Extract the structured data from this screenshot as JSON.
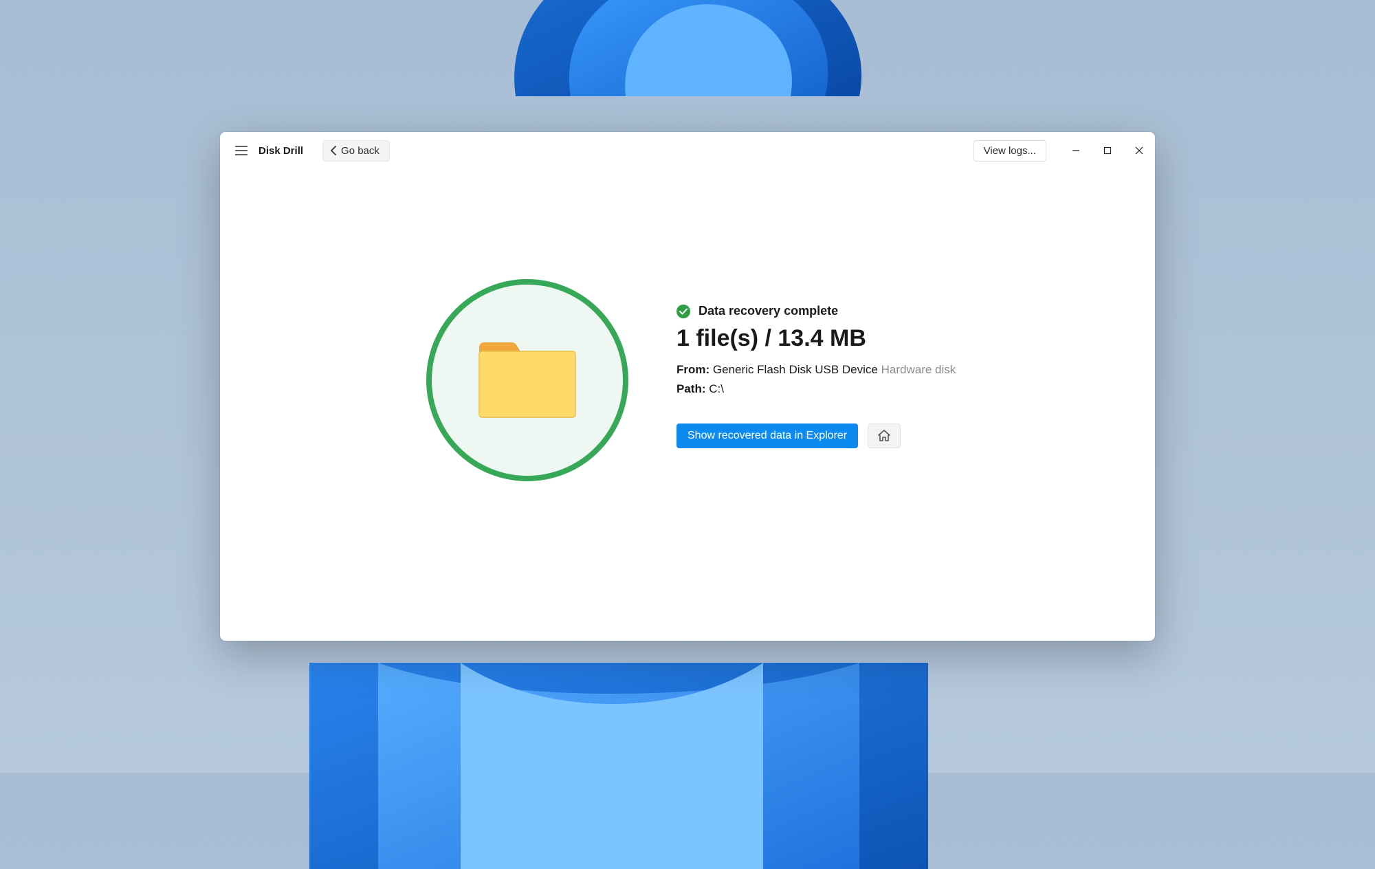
{
  "app": {
    "title": "Disk Drill"
  },
  "toolbar": {
    "go_back_label": "Go back",
    "view_logs_label": "View logs..."
  },
  "result": {
    "status_text": "Data recovery complete",
    "headline": "1 file(s) / 13.4 MB",
    "from_label": "From:",
    "from_device": "Generic Flash Disk USB Device",
    "from_type": "Hardware disk",
    "path_label": "Path:",
    "path_value": "C:\\",
    "show_button": "Show recovered data in Explorer"
  }
}
